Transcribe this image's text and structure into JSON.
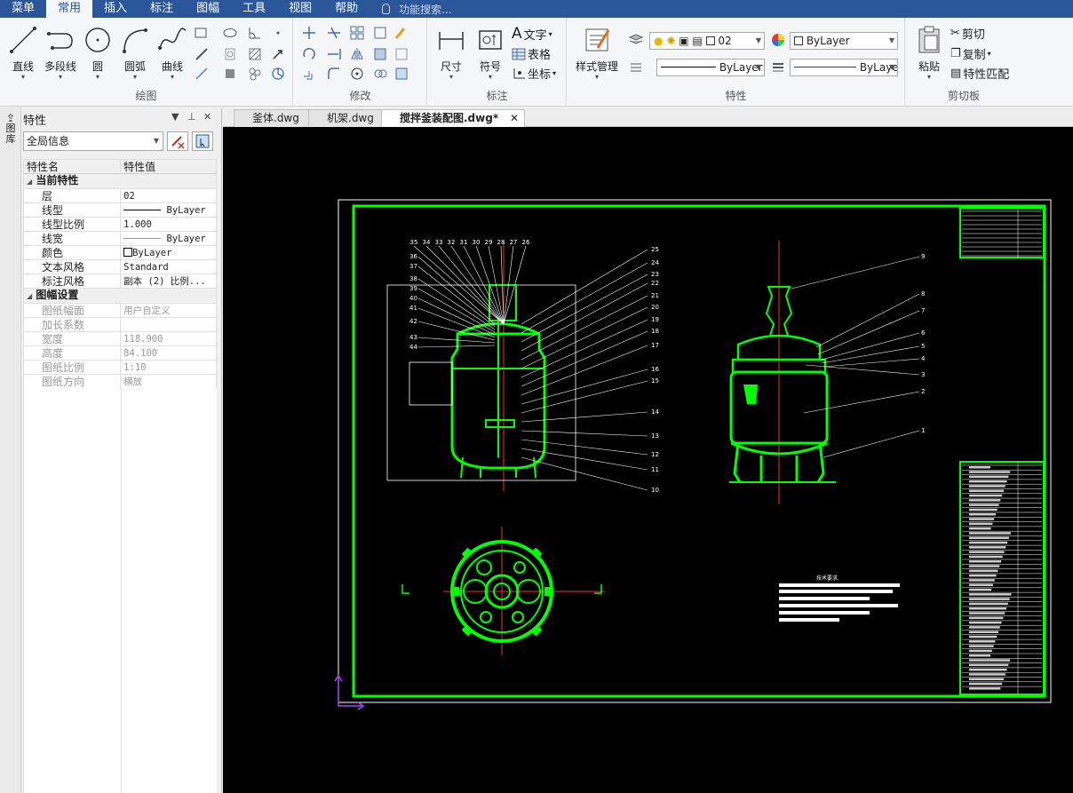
{
  "menubar": {
    "items": [
      "菜单",
      "常用",
      "插入",
      "标注",
      "图幅",
      "工具",
      "视图",
      "帮助"
    ],
    "search": "功能搜索..."
  },
  "ribbon": {
    "draw": {
      "label": "绘图",
      "line": "直线",
      "polyline": "多段线",
      "circle": "圆",
      "arc": "圆弧",
      "curve": "曲线"
    },
    "modify": {
      "label": "修改"
    },
    "annotate": {
      "label": "标注",
      "dimension": "尺寸",
      "symbol": "符号",
      "text": "文字",
      "table": "表格",
      "coordinate": "坐标"
    },
    "properties": {
      "label": "特性",
      "style_manager": "样式管理",
      "layer_value": "02",
      "color_value": "ByLayer",
      "linetype_value": "ByLayer",
      "lineweight_value": "ByLaye"
    },
    "clipboard": {
      "label": "剪切板",
      "paste": "粘贴",
      "cut": "剪切",
      "copy": "复制",
      "match": "特性匹配"
    }
  },
  "panel": {
    "side_tab": "图库",
    "title": "特性",
    "scope": "全局信息",
    "header_name": "特性名",
    "header_value": "特性值",
    "section_current": "当前特性",
    "rows_current": [
      {
        "name": "层",
        "value": "02"
      },
      {
        "name": "线型",
        "value": "ByLayer"
      },
      {
        "name": "线型比例",
        "value": "1.000"
      },
      {
        "name": "线宽",
        "value": "ByLayer"
      },
      {
        "name": "颜色",
        "value": "ByLayer"
      },
      {
        "name": "文本风格",
        "value": "Standard"
      },
      {
        "name": "标注风格",
        "value": "副本 (2) 比例..."
      }
    ],
    "section_sheet": "图幅设置",
    "rows_sheet": [
      {
        "name": "图纸幅面",
        "value": "用户自定义"
      },
      {
        "name": "加长系数",
        "value": ""
      },
      {
        "name": "宽度",
        "value": "118.900"
      },
      {
        "name": "高度",
        "value": "84.100"
      },
      {
        "name": "图纸比例",
        "value": "1:10"
      },
      {
        "name": "图纸方向",
        "value": "横放"
      }
    ]
  },
  "tabs": [
    {
      "label": "釜体.dwg"
    },
    {
      "label": "机架.dwg"
    },
    {
      "label": "搅拌釜装配图.dwg*"
    }
  ],
  "drawing": {
    "notes_title": "技术要求",
    "callouts_left": [
      "35",
      "34",
      "33",
      "32",
      "31",
      "30",
      "29",
      "28",
      "27",
      "26",
      "25",
      "24",
      "23",
      "22",
      "21",
      "20",
      "19",
      "18",
      "17",
      "16",
      "15",
      "14",
      "13",
      "12",
      "11",
      "10",
      "36",
      "37",
      "38",
      "39",
      "40",
      "41",
      "42",
      "43",
      "44"
    ],
    "callouts_right": [
      "9",
      "8",
      "7",
      "6",
      "5",
      "4",
      "3",
      "2",
      "1"
    ]
  },
  "colors": {
    "menubar": "#2b579a",
    "drawing_green": "#00ff00",
    "drawing_red": "#ff2a2a",
    "canvas": "#000000"
  }
}
